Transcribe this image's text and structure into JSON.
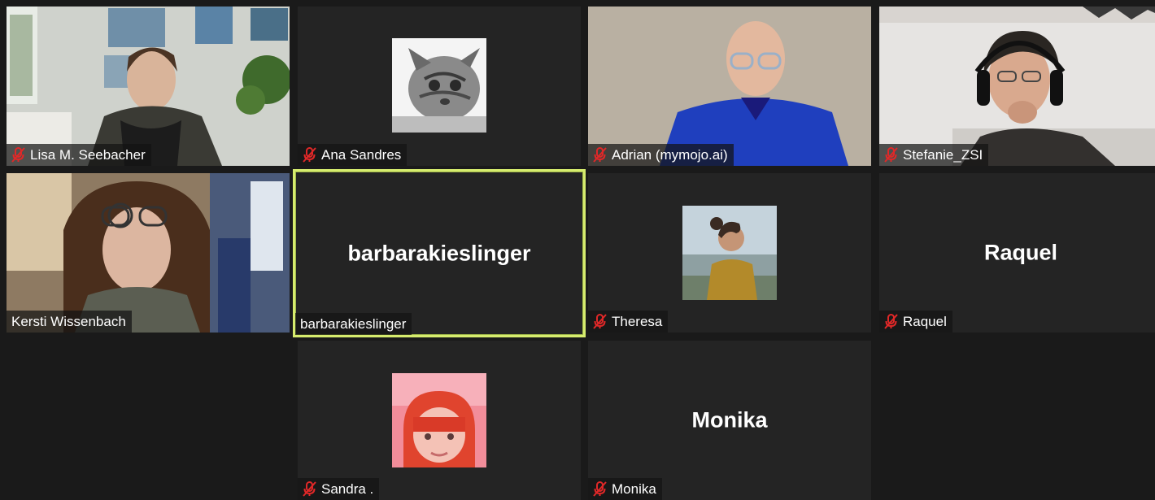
{
  "participants": [
    {
      "name": "Lisa M. Seebacher",
      "muted": true,
      "display": "video"
    },
    {
      "name": "Ana Sandres",
      "muted": true,
      "display": "avatar",
      "avatar_icon": "cat-photo-icon"
    },
    {
      "name": "Adrian (mymojo.ai)",
      "muted": true,
      "display": "video"
    },
    {
      "name": "Stefanie_ZSI",
      "muted": true,
      "display": "video"
    },
    {
      "name": "Kersti Wissenbach",
      "muted": false,
      "display": "video"
    },
    {
      "name": "barbarakieslinger",
      "muted": false,
      "display": "name",
      "active_speaker": true
    },
    {
      "name": "Theresa",
      "muted": true,
      "display": "avatar",
      "avatar_icon": "profile-photo-icon"
    },
    {
      "name": "Raquel",
      "muted": true,
      "display": "name"
    },
    {
      "name": "Sandra .",
      "muted": true,
      "display": "avatar",
      "avatar_icon": "profile-photo-icon"
    },
    {
      "name": "Monika",
      "muted": true,
      "display": "name"
    }
  ],
  "big_names": {
    "barbarakieslinger": "barbarakieslinger",
    "raquel": "Raquel",
    "monika": "Monika"
  },
  "colors": {
    "active_speaker_border": "#d6ec6e",
    "mute_icon": "#e02828",
    "tile_background": "#242424",
    "app_background": "#1a1a1a"
  }
}
